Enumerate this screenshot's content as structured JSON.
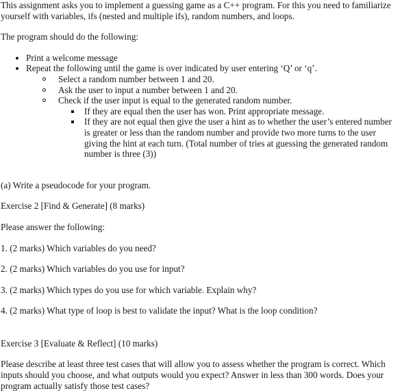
{
  "document": {
    "intro": {
      "paragraph": "This assignment asks you to implement a guessing game as a C++ program. For this you need to familiarize yourself with variables, ifs (nested and multiple ifs), random numbers, and loops.",
      "lead_in": "The program should do the following:"
    },
    "requirements": [
      {
        "level": 1,
        "bullet": "disc",
        "text": "Print a welcome message"
      },
      {
        "level": 1,
        "bullet": "disc",
        "text": "Repeat the following until the game is over indicated by user entering ‘Q’ or ‘q’."
      },
      {
        "level": 2,
        "bullet": "circle",
        "text": "Select a random number between 1 and 20."
      },
      {
        "level": 2,
        "bullet": "circle",
        "text": "Ask the user to input a number between 1 and 20."
      },
      {
        "level": 2,
        "bullet": "circle",
        "text": "Check if the user input is equal to the generated random number."
      },
      {
        "level": 3,
        "bullet": "square",
        "text": "If they are equal then the user has won. Print appropriate message."
      },
      {
        "level": 3,
        "bullet": "square",
        "text": "If they are not equal then give the user a hint as to whether the user’s entered number is greater or less than the random number and provide two more turns to the user giving the hint at each turn. (Total number of tries at guessing the generated random number is three (3))"
      }
    ],
    "task_a": "(a) Write a pseudocode for your program.",
    "exercise2": {
      "heading": "Exercise 2 [Find & Generate] (8 marks)",
      "lead_in": "Please answer the following:",
      "questions": [
        "1. (2 marks) Which variables do you need?",
        "2. (2 marks) Which variables do you use for input?",
        "3. (2 marks) Which types do you use for which variable. Explain why?",
        "4. (2 marks) What type of loop is best to validate the input? What is the loop condition?"
      ]
    },
    "exercise3": {
      "heading": "Exercise 3 [Evaluate & Reflect] (10 marks)",
      "body": "Please describe at least three test cases that will allow you to assess whether the program is correct. Which inputs should you choose, and what outputs would you expect? Answer in less than 300 words. Does your program actually satisfy those test cases?"
    }
  }
}
